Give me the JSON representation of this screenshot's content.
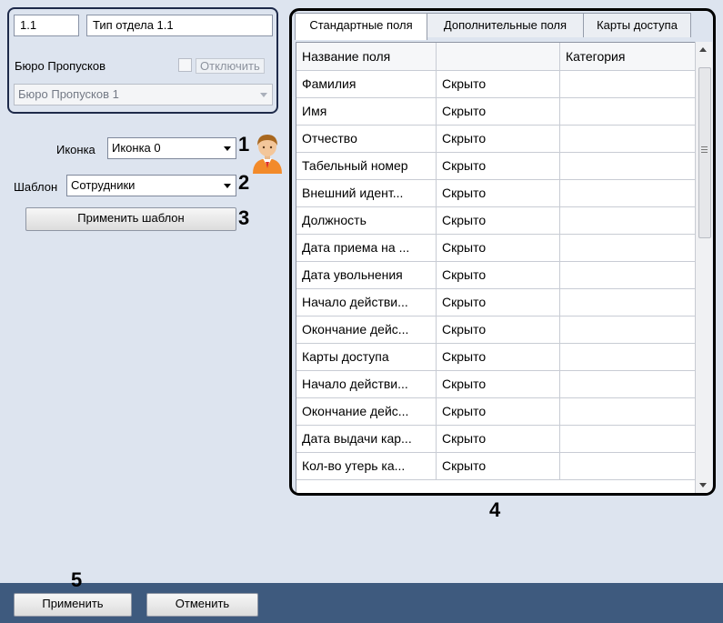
{
  "department": {
    "code": "1.1",
    "name": "Тип отдела 1.1",
    "bureau_label": "Бюро Пропусков",
    "disable_label": "Отключить",
    "bureau_value": "Бюро Пропусков 1"
  },
  "icon_row": {
    "label": "Иконка",
    "value": "Иконка 0",
    "marker": "1"
  },
  "template_row": {
    "label": "Шаблон",
    "value": "Сотрудники",
    "marker": "2"
  },
  "apply_template": {
    "label": "Применить шаблон",
    "marker": "3"
  },
  "tabs": [
    "Стандартные поля",
    "Дополнительные поля",
    "Карты доступа"
  ],
  "table": {
    "headers": [
      "Название поля",
      "",
      "Категория"
    ],
    "rows": [
      [
        "Фамилия",
        "Скрыто",
        ""
      ],
      [
        "Имя",
        "Скрыто",
        ""
      ],
      [
        "Отчество",
        "Скрыто",
        ""
      ],
      [
        "Табельный номер",
        "Скрыто",
        ""
      ],
      [
        "Внешний идент...",
        "Скрыто",
        ""
      ],
      [
        "Должность",
        "Скрыто",
        ""
      ],
      [
        "Дата приема на ...",
        "Скрыто",
        ""
      ],
      [
        "Дата увольнения",
        "Скрыто",
        ""
      ],
      [
        "Начало действи...",
        "Скрыто",
        ""
      ],
      [
        "Окончание дейс...",
        "Скрыто",
        ""
      ],
      [
        "Карты доступа",
        "Скрыто",
        ""
      ],
      [
        "Начало действи...",
        "Скрыто",
        ""
      ],
      [
        "Окончание дейс...",
        "Скрыто",
        ""
      ],
      [
        "Дата выдачи кар...",
        "Скрыто",
        ""
      ],
      [
        "Кол-во утерь ка...",
        "Скрыто",
        ""
      ]
    ]
  },
  "table_marker": "4",
  "bottom": {
    "apply": "Применить",
    "cancel": "Отменить",
    "marker": "5"
  },
  "icons": {
    "avatar": "user-avatar-icon",
    "scroll_up": "scroll-up-icon",
    "scroll_down": "scroll-down-icon"
  }
}
